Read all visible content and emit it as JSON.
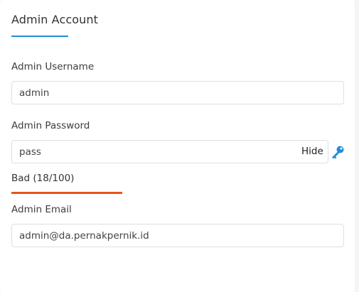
{
  "section": {
    "title": "Admin Account"
  },
  "username": {
    "label": "Admin Username",
    "value": "admin"
  },
  "password": {
    "label": "Admin Password",
    "value": "pass",
    "toggle_label": "Hide",
    "strength_text": "Bad (18/100)",
    "strength_score": 18,
    "strength_color": "#e4551c"
  },
  "email": {
    "label": "Admin Email",
    "value": "admin@da.pernakpernik.id"
  },
  "colors": {
    "accent": "#1e8fdc",
    "key_icon": "#1e8fdc"
  },
  "icons": {
    "generate_password": "key-icon"
  }
}
